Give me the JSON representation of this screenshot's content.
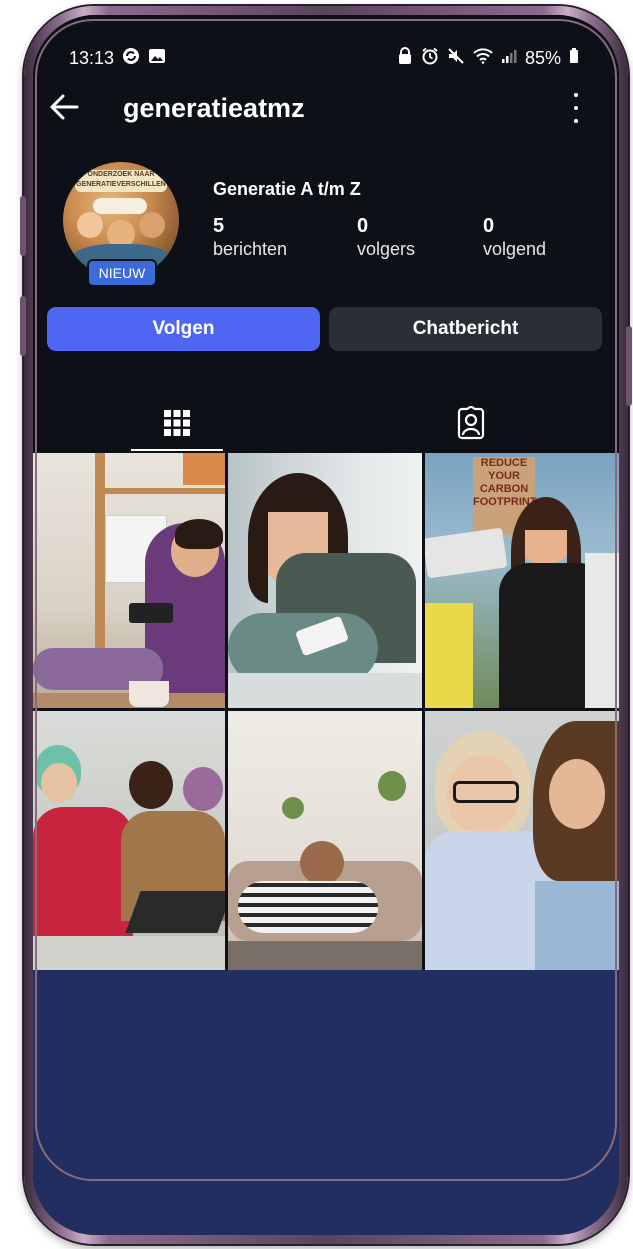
{
  "status_bar": {
    "time": "13:13",
    "battery": "85%"
  },
  "header": {
    "back_icon": "arrow-left-icon",
    "username": "generatieatmz",
    "more_icon": "more-vertical-icon"
  },
  "profile": {
    "avatar_text": "ONDERZOEK NAAR GENERATIEVERSCHILLEN",
    "badge": "NIEUW",
    "name": "Generatie A t/m Z",
    "stats": [
      {
        "value": "5",
        "label": "berichten"
      },
      {
        "value": "0",
        "label": "volgers"
      },
      {
        "value": "0",
        "label": "volgend"
      }
    ],
    "follow_label": "Volgen",
    "message_label": "Chatbericht"
  },
  "tabs": [
    {
      "icon": "grid-icon",
      "active": true
    },
    {
      "icon": "tagged-person-icon",
      "active": false
    }
  ],
  "posts": [
    {
      "description": "woman-playing-phone-game"
    },
    {
      "description": "sad-teen-with-phone"
    },
    {
      "description": "climate-protest",
      "sign_text": "REDUCE YOUR CARBON FOOTPRINT"
    },
    {
      "description": "office-workers-laptops"
    },
    {
      "description": "woman-relaxing-headphones"
    },
    {
      "description": "older-and-younger-woman-at-laptop"
    }
  ],
  "colors": {
    "background": "#0d1117",
    "follow_button": "#4f66f2",
    "message_button": "#2a2e36",
    "badge": "#3b6bd8",
    "bottom_fill": "#222e60"
  }
}
